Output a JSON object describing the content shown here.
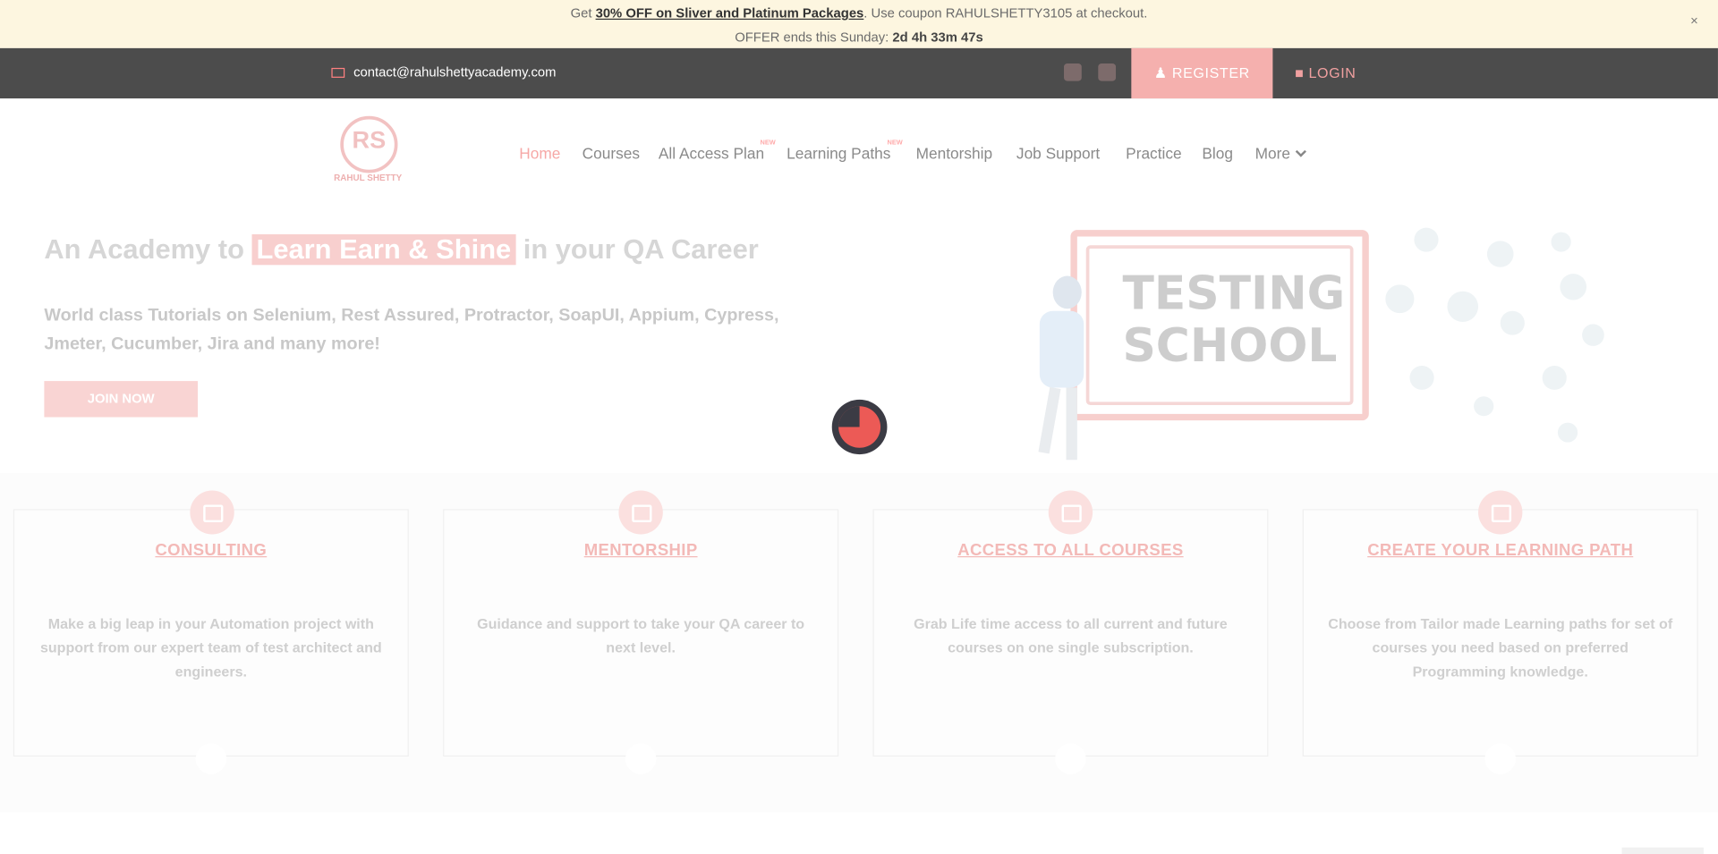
{
  "promo": {
    "line1_pre": "Get ",
    "line1_link": "30% OFF on Sliver and Platinum Packages",
    "line1_post": ". Use coupon RAHULSHETTY3105 at checkout.",
    "line2_pre": "OFFER ends this Sunday: ",
    "countdown": "2d 4h 33m 47s",
    "close": "×"
  },
  "topbar": {
    "email": "contact@rahulshettyacademy.com",
    "register": "REGISTER",
    "login": "LOGIN"
  },
  "logo": {
    "mark": "RS",
    "brand": "RAHUL SHETTY"
  },
  "nav": {
    "items": [
      "Home",
      "Courses",
      "All Access Plan",
      "Learning Paths",
      "Mentorship",
      "Job Support",
      "Practice",
      "Blog",
      "More"
    ],
    "badge": "NEW"
  },
  "hero": {
    "title_pre": "An Academy to ",
    "title_highlight": "Learn Earn & Shine",
    "title_post": "  in your QA Career",
    "subtitle": "World class Tutorials on Selenium, Rest Assured, Protractor, SoapUI, Appium, Cypress, Jmeter, Cucumber, Jira and many more!",
    "cta": "JOIN NOW",
    "board_line1": "TESTING",
    "board_line2": "SCHOOL"
  },
  "features": [
    {
      "title": "CONSULTING",
      "desc": "Make a big leap in your Automation project with support from our expert team of test architect and engineers."
    },
    {
      "title": "MENTORSHIP",
      "desc": "Guidance and support to take your QA career to next level."
    },
    {
      "title": "ACCESS TO ALL COURSES",
      "desc": "Grab Life time access to all current and future courses on one single subscription."
    },
    {
      "title": "CREATE YOUR LEARNING PATH",
      "desc": "Choose from Tailor made Learning paths for set of courses you need based on preferred Programming knowledge."
    }
  ],
  "colors": {
    "accent": "#ec5a56",
    "dark": "#3b3b44",
    "topbar": "#4c4c4c",
    "promo_bg": "#fdf6e0"
  }
}
